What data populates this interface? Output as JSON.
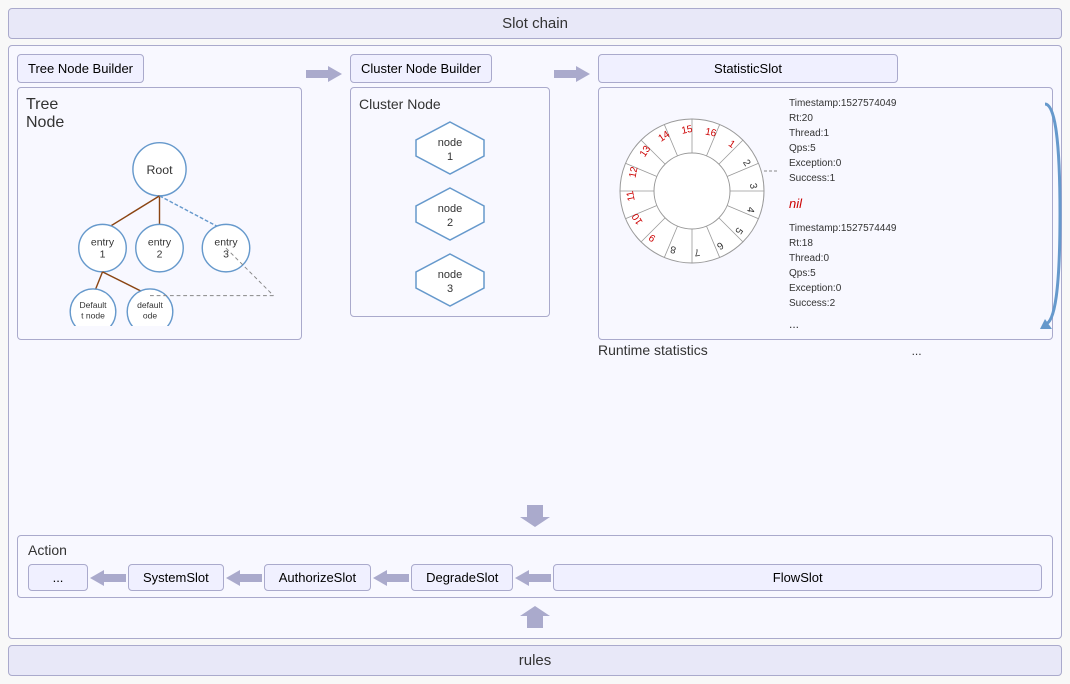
{
  "slotChain": {
    "title": "Slot chain"
  },
  "treeNodeBuilder": {
    "label": "Tree Node Builder",
    "areaLabel": "Tree\nNode",
    "nodes": {
      "root": "Root",
      "entry1": "entry\n1",
      "entry2": "entry\n2",
      "entry3": "entry\n3",
      "defaultNode": "Default\nt node",
      "defaultOde": "default\node"
    }
  },
  "clusterNodeBuilder": {
    "label": "Cluster Node Builder",
    "areaLabel": "Cluster Node",
    "nodes": [
      "node\n1",
      "node\n2",
      "node\n3"
    ]
  },
  "statisticSlot": {
    "label": "StatisticSlot",
    "nilLabel": "nil",
    "stats1": {
      "timestamp": "Timestamp:1527574049",
      "rt": "Rt:20",
      "thread": "Thread:1",
      "qps": "Qps:5",
      "exception": "Exception:0",
      "success": "Success:1"
    },
    "stats2": {
      "timestamp": "Timestamp:1527574449",
      "rt": "Rt:18",
      "thread": "Thread:0",
      "qps": "Qps:5",
      "exception": "Exception:0",
      "success": "Success:2"
    },
    "ellipsis": "...",
    "wheelNumbers": [
      "1",
      "2",
      "3",
      "4",
      "5",
      "6",
      "7",
      "8",
      "9",
      "10",
      "11",
      "12",
      "13",
      "14",
      "15",
      "16"
    ]
  },
  "runtimeStats": {
    "label": "Runtime statistics",
    "ellipsis": "..."
  },
  "action": {
    "label": "Action",
    "slots": [
      "...",
      "SystemSlot",
      "AuthorizeSlot",
      "DegradeSlot",
      "FlowSlot"
    ]
  },
  "rules": {
    "title": "rules"
  },
  "arrows": {
    "rightLabel": "→",
    "leftLabel": "←",
    "downLabel": "↓",
    "upLabel": "↑"
  }
}
